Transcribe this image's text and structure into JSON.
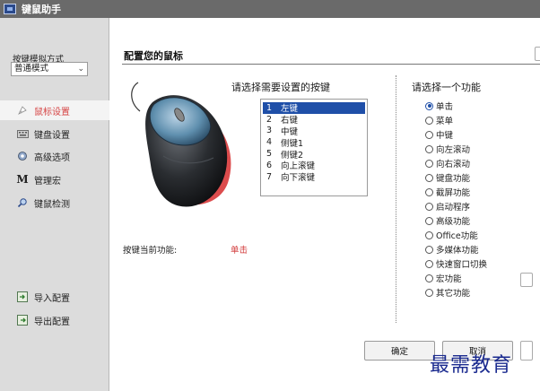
{
  "window": {
    "title": "键鼠助手"
  },
  "sidebar": {
    "mode_label": "按键模拟方式",
    "mode_value": "普通模式",
    "items": [
      {
        "label": "鼠标设置",
        "icon": "mouse-settings-icon",
        "active": true
      },
      {
        "label": "键盘设置",
        "icon": "keyboard-icon",
        "active": false
      },
      {
        "label": "高级选项",
        "icon": "advanced-options-icon",
        "active": false
      },
      {
        "label": "管理宏",
        "icon": "macro-m-icon",
        "active": false
      },
      {
        "label": "键鼠检测",
        "icon": "detect-icon",
        "active": false
      }
    ],
    "bottom_items": [
      {
        "label": "导入配置",
        "icon": "import-icon"
      },
      {
        "label": "导出配置",
        "icon": "export-icon"
      }
    ]
  },
  "main": {
    "title": "配置您的鼠标",
    "key_heading": "请选择需要设置的按键",
    "keys": [
      {
        "num": "1",
        "label": "左键",
        "selected": true
      },
      {
        "num": "2",
        "label": "右键",
        "selected": false
      },
      {
        "num": "3",
        "label": "中键",
        "selected": false
      },
      {
        "num": "4",
        "label": "侧键1",
        "selected": false
      },
      {
        "num": "5",
        "label": "侧键2",
        "selected": false
      },
      {
        "num": "6",
        "label": "向上滚键",
        "selected": false
      },
      {
        "num": "7",
        "label": "向下滚键",
        "selected": false
      }
    ],
    "current_function_label": "按键当前功能:",
    "current_function_value": "单击",
    "function_heading": "请选择一个功能",
    "functions": [
      {
        "label": "单击",
        "checked": true
      },
      {
        "label": "菜单",
        "checked": false
      },
      {
        "label": "中键",
        "checked": false
      },
      {
        "label": "向左滚动",
        "checked": false
      },
      {
        "label": "向右滚动",
        "checked": false
      },
      {
        "label": "键盘功能",
        "checked": false
      },
      {
        "label": "截屏功能",
        "checked": false
      },
      {
        "label": "启动程序",
        "checked": false
      },
      {
        "label": "高级功能",
        "checked": false
      },
      {
        "label": "Office功能",
        "checked": false
      },
      {
        "label": "多媒体功能",
        "checked": false
      },
      {
        "label": "快速窗口切换",
        "checked": false
      },
      {
        "label": "宏功能",
        "checked": false
      },
      {
        "label": "其它功能",
        "checked": false
      }
    ],
    "ok_label": "确定",
    "cancel_label": "取消"
  },
  "brand": {
    "corner_text": "最需教育"
  },
  "colors": {
    "accent": "#1f4fa8",
    "active_nav_text": "#d64545",
    "current_value": "#d23a3a",
    "titlebar": "#6a6a6a",
    "sidebar_bg": "#dcdcdc"
  }
}
